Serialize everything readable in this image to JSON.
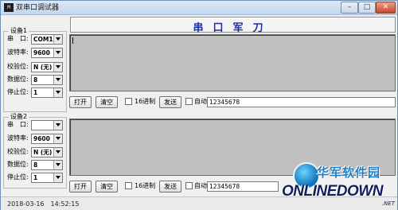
{
  "window": {
    "title": "双串口调试器",
    "app_icon_text": "M",
    "controls": {
      "minimize": "–",
      "maximize": "□",
      "close": "✕"
    }
  },
  "banner": {
    "text": "串口军刀"
  },
  "port1": {
    "group_title": "设备1",
    "fields": [
      {
        "label": "串　口:",
        "value": "COM1"
      },
      {
        "label": "波特率:",
        "value": "9600"
      },
      {
        "label": "校验位:",
        "value": "N (无)"
      },
      {
        "label": "数据位:",
        "value": "8"
      },
      {
        "label": "停止位:",
        "value": "1"
      }
    ],
    "open_button": "打开",
    "clear_button": "清空",
    "hex_label": "16进制",
    "send_button": "发送",
    "auto_label": "自动",
    "send_text": "12345678"
  },
  "port2": {
    "group_title": "设备2",
    "fields": [
      {
        "label": "串　口:",
        "value": ""
      },
      {
        "label": "波特率:",
        "value": "9600"
      },
      {
        "label": "校验位:",
        "value": "N (无)"
      },
      {
        "label": "数据位:",
        "value": "8"
      },
      {
        "label": "停止位:",
        "value": "1"
      }
    ],
    "open_button": "打开",
    "clear_button": "清空",
    "hex_label": "16进制",
    "send_button": "发送",
    "auto_label": "自动",
    "send_text": "12345678"
  },
  "statusbar": {
    "datetime": "2018-03-16　14:52:15"
  },
  "watermark": {
    "cn": "华军软件园",
    "en": "ONLINEDOWN",
    "suffix": ".NET"
  },
  "colors": {
    "title_blue": "#1e2ea8",
    "recv_gray": "#c0c0c0",
    "window_bg": "#f0f0f0"
  }
}
